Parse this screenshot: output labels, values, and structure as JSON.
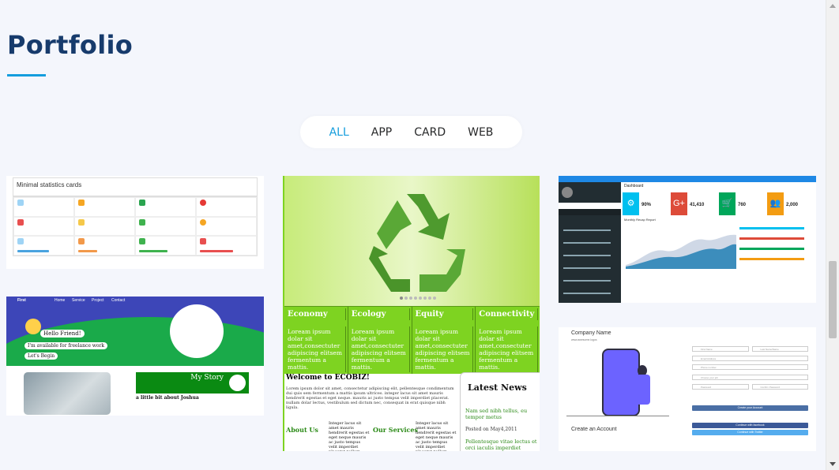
{
  "section": {
    "title": "Portfolio"
  },
  "filters": [
    {
      "label": "ALL",
      "active": true
    },
    {
      "label": "APP",
      "active": false
    },
    {
      "label": "CARD",
      "active": false
    },
    {
      "label": "WEB",
      "active": false
    }
  ],
  "cards": {
    "stats": {
      "title": "Minimal statistics cards"
    },
    "ecobiz": {
      "tabs": [
        "Economy",
        "Ecology",
        "Equity",
        "Connectivity"
      ],
      "tab_text": "Loream ipsum dolar sit amet,consectuter adipiscing elitsem fermentum a mattis.",
      "welcome": "Welcome to ECOBIZ!",
      "lorem": "Lorem ipsum dolor sit amet, consectetur adipiscing elit, pellentesque condimentum dui quis sem fermentum a mattis ipsum ultrices. integer lacus sit amet mauris hendrerit egestas et eget neque. mauris ac justo tempus velit imperdiet placerat. nullam dolar lectus, vestibulum sed dictum nec, consequat in erat quisque nibh ligula.",
      "about": "About Us",
      "services": "Our Services",
      "col_text": "Integer lacus sit amet mauris hendrerit egestas et eget neque mauris ac justo tempus velit imperdiet placerat nullam dolar",
      "news_title": "Latest News",
      "news_link": "Nam sed nibh tellus, eu tempor metus",
      "news_date": "Posted on May4,2011",
      "news_more": "Pellentesque vitae lectus et orci iaculis imperdiet"
    },
    "dashboard": {
      "title": "Dashboard",
      "tiles": [
        {
          "value": "90%",
          "color": "#00c0ef",
          "icon": "⚙"
        },
        {
          "value": "41,410",
          "color": "#dd4b39",
          "icon": "G+"
        },
        {
          "value": "760",
          "color": "#00a65a",
          "icon": "🛒"
        },
        {
          "value": "2,000",
          "color": "#f39c12",
          "icon": "👥"
        }
      ],
      "chart_title": "Monthly Recap Report"
    },
    "first": {
      "nav": [
        "First",
        "Home",
        "Service",
        "Project",
        "Contact"
      ],
      "hello": "Hello Friend!",
      "freelance": "I'm available for freelance work",
      "begin": "Let's Begin",
      "story": "My Story",
      "little": "a little bit about Joshua"
    },
    "account": {
      "company": "Company Name",
      "tagline": "www.awesome.logos",
      "create": "Create an Account",
      "fields": [
        "First Name",
        "Last Name/Name",
        "Email Address",
        "Phone number",
        "Choose your job",
        "Password",
        "Confirm Password"
      ],
      "btn_create": "Create your Account",
      "btn_fb": "Continue with facebook",
      "btn_tw": "Continue with Twitter"
    }
  }
}
